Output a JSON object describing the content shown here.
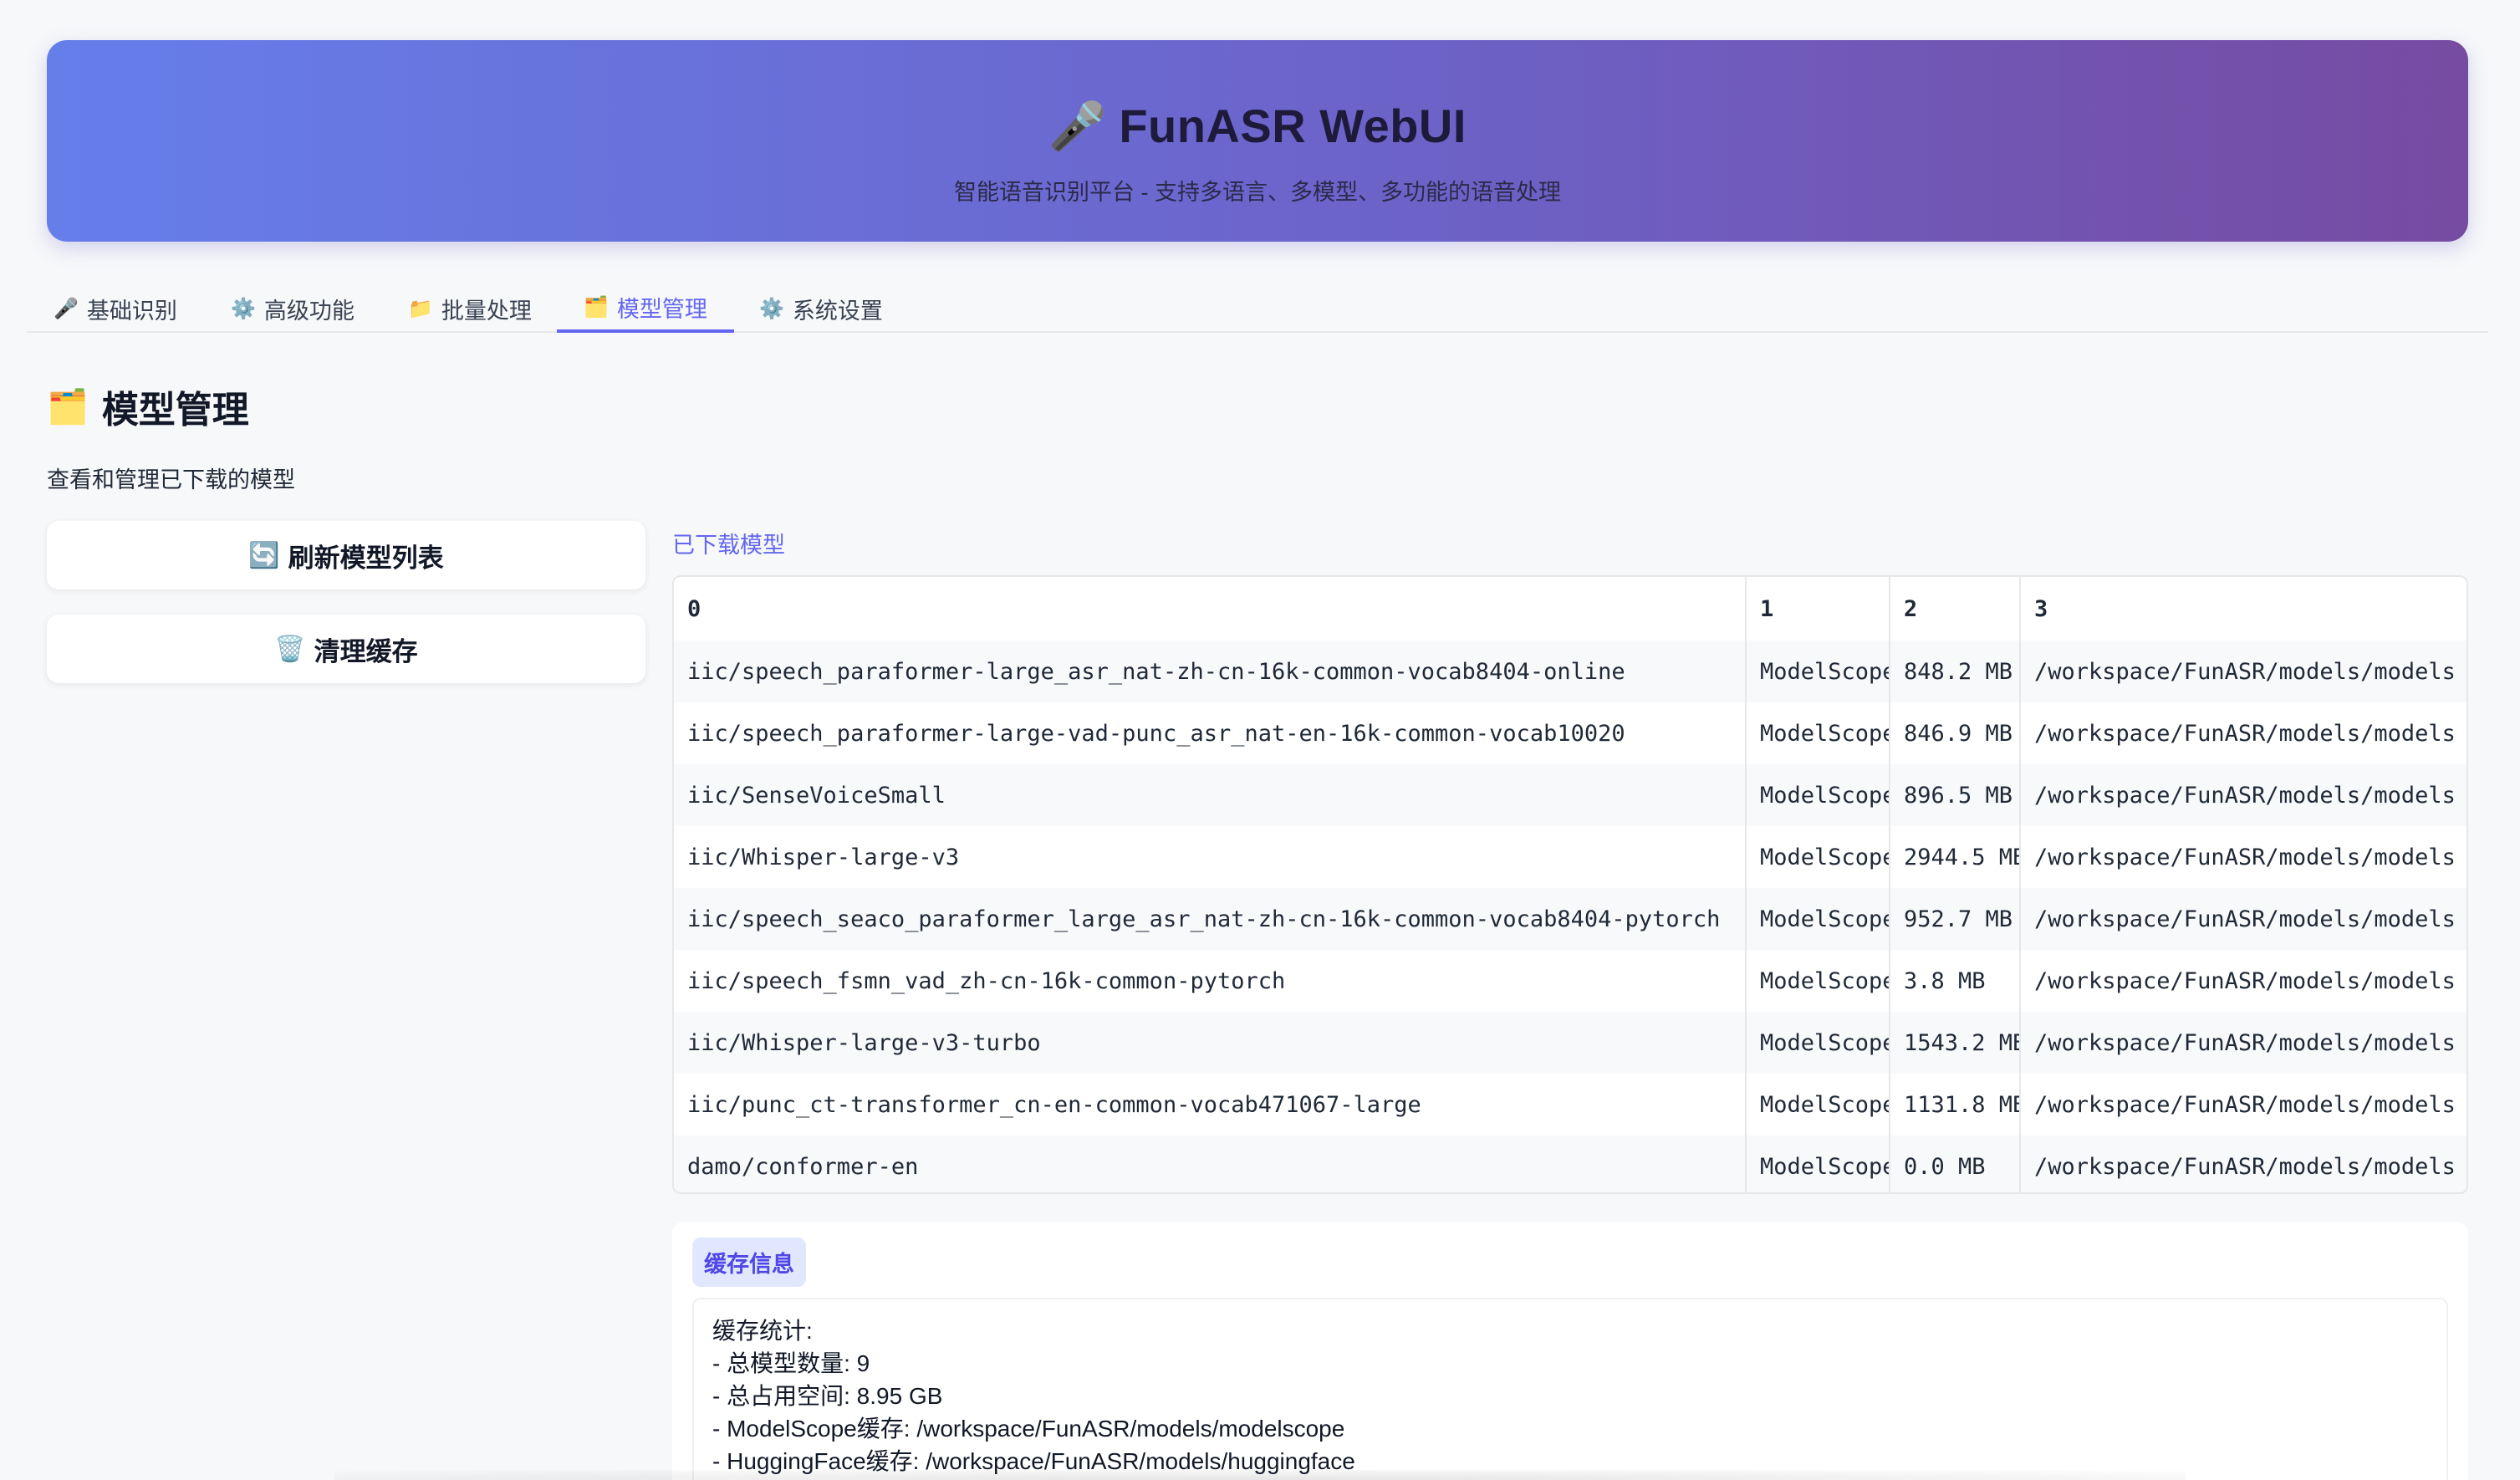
{
  "header": {
    "icon": "🎤",
    "title": "FunASR WebUI",
    "subtitle": "智能语音识别平台 - 支持多语言、多模型、多功能的语音处理"
  },
  "tabs": [
    {
      "icon": "🎤",
      "label": "基础识别"
    },
    {
      "icon": "⚙️",
      "label": "高级功能"
    },
    {
      "icon": "📁",
      "label": "批量处理"
    },
    {
      "icon": "🗂️",
      "label": "模型管理",
      "active": true
    },
    {
      "icon": "⚙️",
      "label": "系统设置"
    }
  ],
  "section": {
    "icon": "🗂️",
    "title": "模型管理",
    "description": "查看和管理已下载的模型"
  },
  "buttons": {
    "refresh": {
      "icon": "🔄",
      "label": "刷新模型列表"
    },
    "clear": {
      "icon": "🗑️",
      "label": "清理缓存"
    }
  },
  "table": {
    "label": "已下载模型",
    "headers": [
      "0",
      "1",
      "2",
      "3"
    ],
    "rows": [
      [
        "iic/speech_paraformer-large_asr_nat-zh-cn-16k-common-vocab8404-online",
        "ModelScope",
        "848.2 MB",
        "/workspace/FunASR/models/models"
      ],
      [
        "iic/speech_paraformer-large-vad-punc_asr_nat-en-16k-common-vocab10020",
        "ModelScope",
        "846.9 MB",
        "/workspace/FunASR/models/models"
      ],
      [
        "iic/SenseVoiceSmall",
        "ModelScope",
        "896.5 MB",
        "/workspace/FunASR/models/models"
      ],
      [
        "iic/Whisper-large-v3",
        "ModelScope",
        "2944.5 MB",
        "/workspace/FunASR/models/models"
      ],
      [
        "iic/speech_seaco_paraformer_large_asr_nat-zh-cn-16k-common-vocab8404-pytorch",
        "ModelScope",
        "952.7 MB",
        "/workspace/FunASR/models/models"
      ],
      [
        "iic/speech_fsmn_vad_zh-cn-16k-common-pytorch",
        "ModelScope",
        "3.8 MB",
        "/workspace/FunASR/models/models"
      ],
      [
        "iic/Whisper-large-v3-turbo",
        "ModelScope",
        "1543.2 MB",
        "/workspace/FunASR/models/models"
      ],
      [
        "iic/punc_ct-transformer_cn-en-common-vocab471067-large",
        "ModelScope",
        "1131.8 MB",
        "/workspace/FunASR/models/models"
      ],
      [
        "damo/conformer-en",
        "ModelScope",
        "0.0 MB",
        "/workspace/FunASR/models/models"
      ]
    ]
  },
  "cache": {
    "badge": "缓存信息",
    "lines": [
      "缓存统计:",
      "- 总模型数量: 9",
      "- 总占用空间: 8.95 GB",
      "- ModelScope缓存: /workspace/FunASR/models/modelscope",
      "- HuggingFace缓存: /workspace/FunASR/models/huggingface"
    ]
  }
}
